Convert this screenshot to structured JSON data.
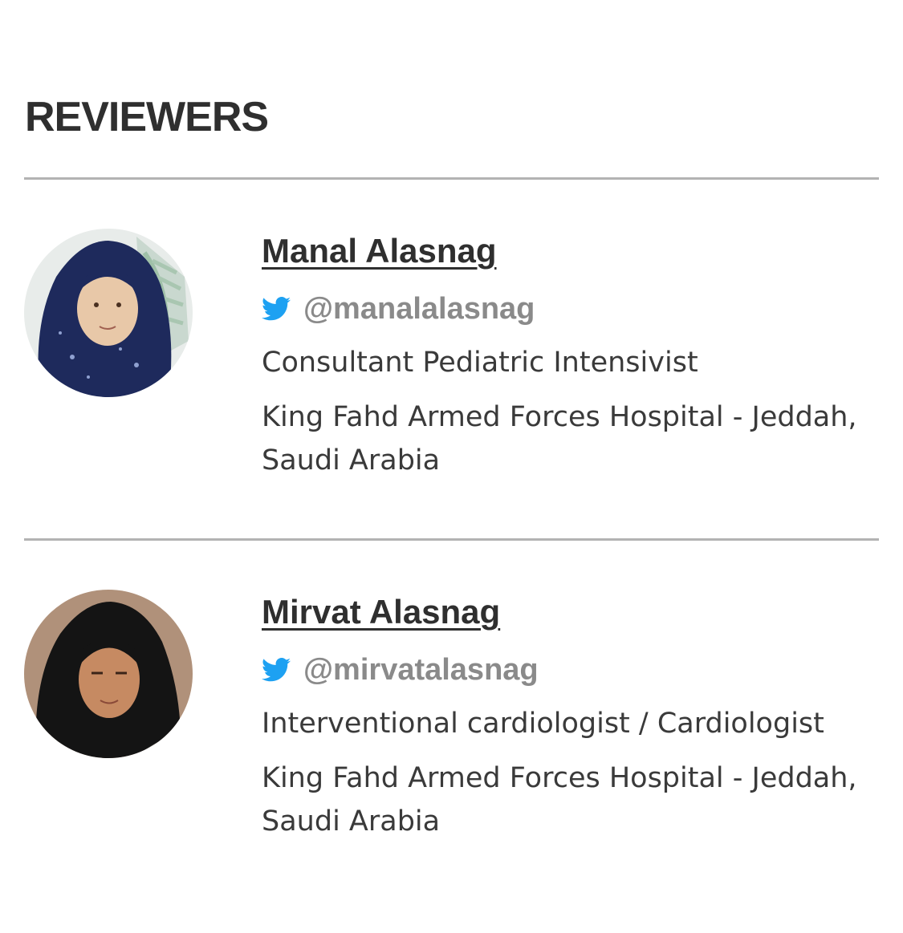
{
  "section": {
    "title": "REVIEWERS"
  },
  "reviewers": [
    {
      "name": "Manal Alasnag",
      "twitter_handle": "@manalalasnag",
      "position": "Consultant Pediatric Intensivist",
      "institution": "King Fahd Armed Forces Hospital - Jeddah, Saudi Arabia",
      "avatar_icon": "reviewer-photo"
    },
    {
      "name": "Mirvat Alasnag",
      "twitter_handle": "@mirvatalasnag",
      "position": "Interventional cardiologist / Cardiologist",
      "institution": "King Fahd Armed Forces Hospital - Jeddah, Saudi Arabia",
      "avatar_icon": "reviewer-photo"
    }
  ],
  "colors": {
    "twitter_blue": "#1DA1F2",
    "heading": "#2f2f2f",
    "handle_gray": "#8a8a8a",
    "divider": "#b3b3b3"
  }
}
